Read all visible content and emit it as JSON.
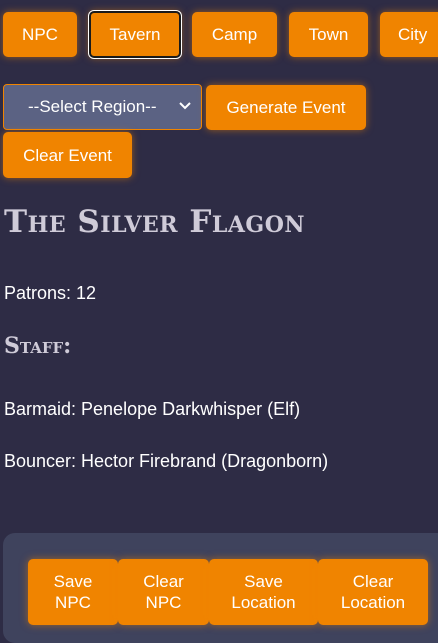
{
  "nav": {
    "npc": "NPC",
    "tavern": "Tavern",
    "camp": "Camp",
    "town": "Town",
    "city": "City"
  },
  "controls": {
    "region_select": "--Select Region--",
    "generate_event": "Generate Event",
    "clear_event": "Clear Event"
  },
  "tavern": {
    "name": "The Silver Flagon",
    "patrons": "Patrons: 12",
    "staff_heading": "Staff:",
    "staff": [
      "Barmaid: Penelope Darkwhisper (Elf)",
      "Bouncer: Hector Firebrand (Dragonborn)"
    ]
  },
  "actions": {
    "save_npc_1": "Save",
    "save_npc_2": "NPC",
    "clear_npc_1": "Clear",
    "clear_npc_2": "NPC",
    "save_location_1": "Save",
    "save_location_2": "Location",
    "clear_location_1": "Clear",
    "clear_location_2": "Location"
  },
  "colors": {
    "accent": "#f08400",
    "background": "#2e2c45",
    "panel": "#3f435d"
  }
}
